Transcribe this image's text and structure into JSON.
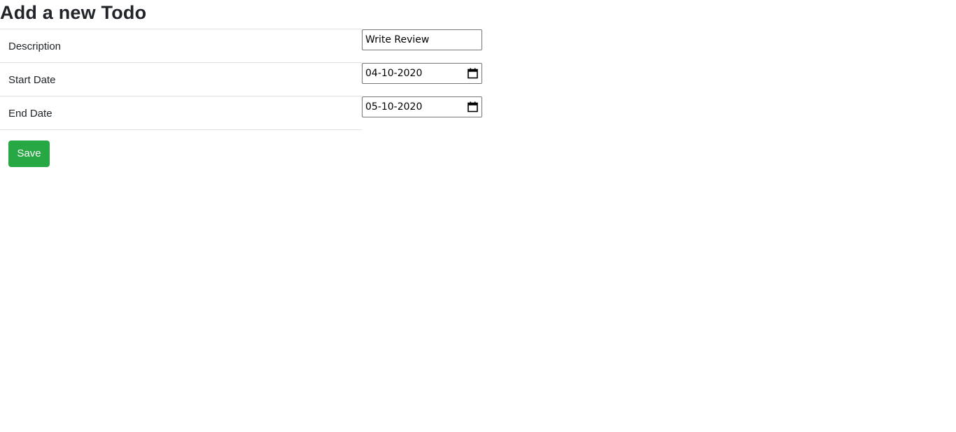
{
  "page": {
    "title": "Add a new Todo"
  },
  "form": {
    "fields": [
      {
        "label": "Description",
        "value": "Write Review",
        "type": "text"
      },
      {
        "label": "Start Date",
        "value": "04-10-2020",
        "type": "date",
        "icon": "calendar-icon"
      },
      {
        "label": "End Date",
        "value": "05-10-2020",
        "type": "date",
        "icon": "calendar-icon"
      }
    ],
    "save_label": "Save"
  },
  "colors": {
    "save_button": "#28a745",
    "border": "#dee2e6",
    "text": "#212529"
  }
}
